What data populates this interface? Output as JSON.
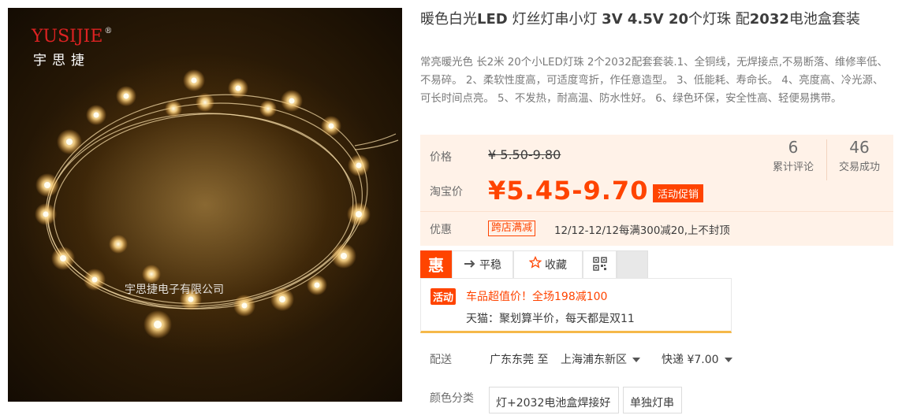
{
  "image": {
    "brand_logo": "YUSIJIE",
    "brand_reg": "®",
    "brand_cn": "宇思捷",
    "watermark": "宇思捷电子有限公司"
  },
  "product": {
    "title_parts": [
      "暖色白光",
      "LED",
      " 灯丝灯串小灯 ",
      "3V 4.5V 20",
      "个灯珠 配",
      "2032",
      "电池盒套装"
    ],
    "subtitle": "常亮暖光色 长2米 20个小LED灯珠 2个2032配套套装.1、全铜线，无焊接点,不易断落、维修率低、不易碎。 2、柔软性度高，可适度弯折，作任意造型。 3、低能耗、寿命长。 4、亮度高、冷光源、可长时间点亮。 5、不发热，耐高温、防水性好。 6、绿色环保，安全性高、轻便易携带。"
  },
  "price": {
    "orig_label": "价格",
    "orig_price": "¥ 5.50-9.80",
    "taobao_label": "淘宝价",
    "sale_price": "¥5.45-9.70",
    "promo_badge": "活动促销",
    "review_count": "6",
    "review_label": "累计评论",
    "sales_count": "46",
    "sales_label": "交易成功",
    "coupon_label": "优惠",
    "coupon_tag": "跨店满减",
    "coupon_text": "12/12-12/12每满300减20,上不封顶",
    "accent_color": "#ff4400",
    "bg_color": "#fff2e8"
  },
  "tabs": {
    "hui_label": "惠",
    "pingwen_label": "平稳",
    "favorite_label": "收藏"
  },
  "activity": {
    "badge": "活动",
    "line1": "车品超值价！全场198减100",
    "line2": "天猫：聚划算半价，每天都是双11"
  },
  "shipping": {
    "label": "配送",
    "from": "广东东莞 至",
    "to": "上海浦东新区",
    "fee": "快递 ¥7.00"
  },
  "sku": {
    "label": "颜色分类",
    "options": [
      "灯+2032电池盒焊接好",
      "单独灯串"
    ]
  }
}
